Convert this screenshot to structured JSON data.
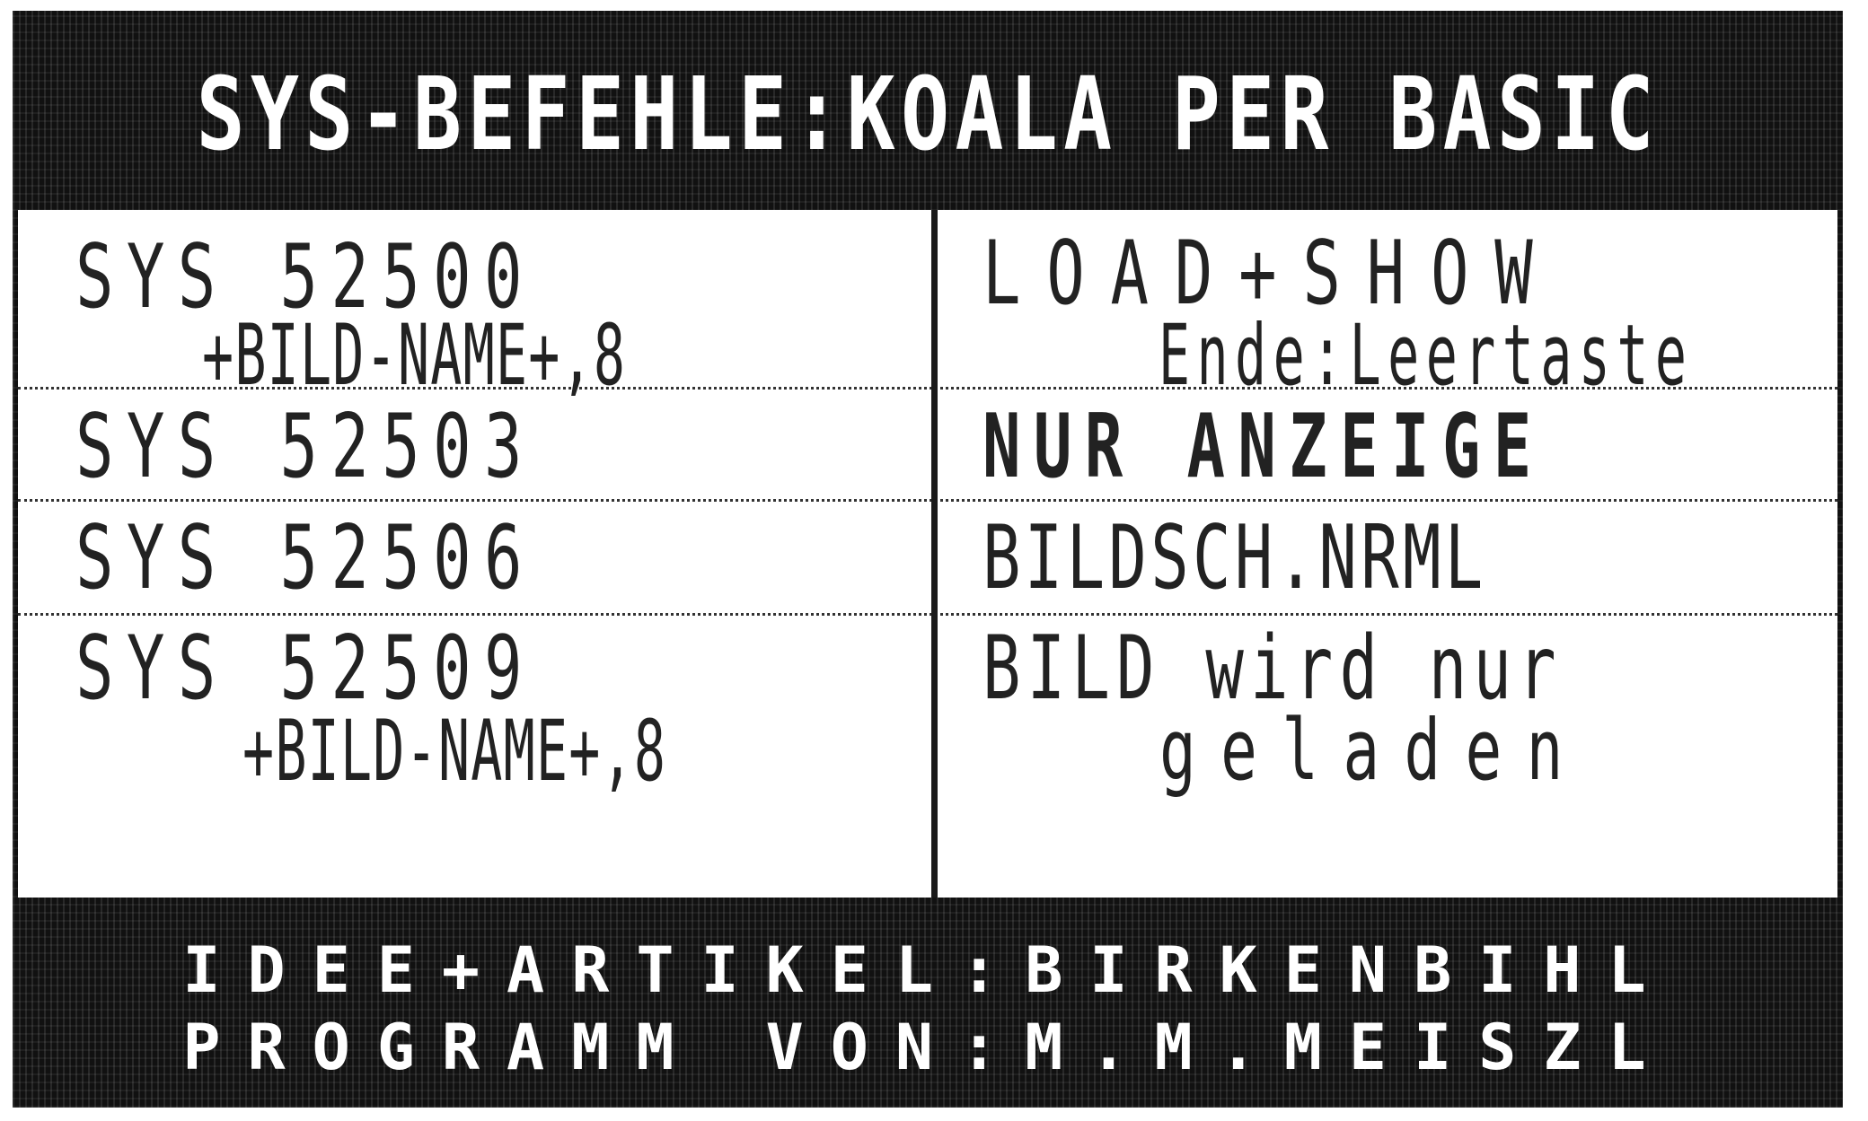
{
  "header": {
    "title": "SYS-BEFEHLE:KOALA PER BASIC"
  },
  "rows": [
    {
      "command_line1": "SYS 52500",
      "command_line2": "+BILD-NAME+,8",
      "description_line1": "LOAD+SHOW",
      "description_line2": "Ende:Leertaste"
    },
    {
      "command_line1": "SYS 52503",
      "description_line1": "NUR ANZEIGE"
    },
    {
      "command_line1": "SYS 52506",
      "description_line1": "BILDSCH.NRML"
    },
    {
      "command_line1": "SYS 52509",
      "command_line2": "+BILD-NAME+,8",
      "description_line1": "BILD wird nur",
      "description_line2": "geladen"
    }
  ],
  "footer": {
    "line1": "IDEE+ARTIKEL:BIRKENBIHL",
    "line2": "PROGRAMM VON:M.M.MEISZL"
  }
}
